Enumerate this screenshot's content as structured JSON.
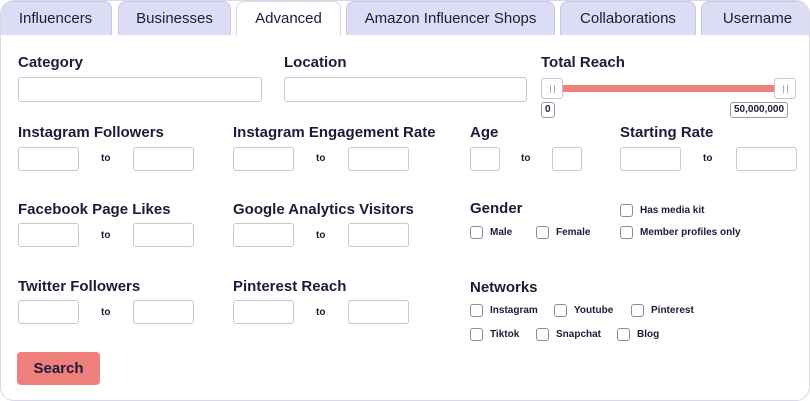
{
  "tabs": [
    {
      "label": "Influencers"
    },
    {
      "label": "Businesses"
    },
    {
      "label": "Advanced"
    },
    {
      "label": "Amazon Influencer Shops"
    },
    {
      "label": "Collaborations"
    },
    {
      "label": "Username"
    }
  ],
  "active_tab": "Advanced",
  "fields": {
    "category": {
      "label": "Category",
      "value": ""
    },
    "location": {
      "label": "Location",
      "value": ""
    },
    "total_reach": {
      "label": "Total Reach",
      "min_label": "0",
      "max_label": "50,000,000",
      "range_selected": [
        0,
        1
      ]
    },
    "instagram_followers": {
      "label": "Instagram Followers",
      "to": "to"
    },
    "instagram_engagement": {
      "label": "Instagram Engagement Rate",
      "to": "to"
    },
    "age": {
      "label": "Age",
      "to": "to"
    },
    "starting_rate": {
      "label": "Starting Rate",
      "to": "to"
    },
    "facebook_likes": {
      "label": "Facebook Page Likes",
      "to": "to"
    },
    "google_visitors": {
      "label": "Google Analytics Visitors",
      "to": "to"
    },
    "twitter_followers": {
      "label": "Twitter Followers",
      "to": "to"
    },
    "pinterest_reach": {
      "label": "Pinterest Reach",
      "to": "to"
    }
  },
  "gender": {
    "label": "Gender",
    "options": [
      "Male",
      "Female"
    ]
  },
  "extra_checks": [
    "Has media kit",
    "Member profiles only"
  ],
  "networks": {
    "label": "Networks",
    "options": [
      "Instagram",
      "Youtube",
      "Pinterest",
      "Tiktok",
      "Snapchat",
      "Blog"
    ]
  },
  "search_button": "Search",
  "colors": {
    "accent": "#ef7f7b",
    "tab_bg": "#dcdcf5",
    "text": "#1c1c3a"
  }
}
